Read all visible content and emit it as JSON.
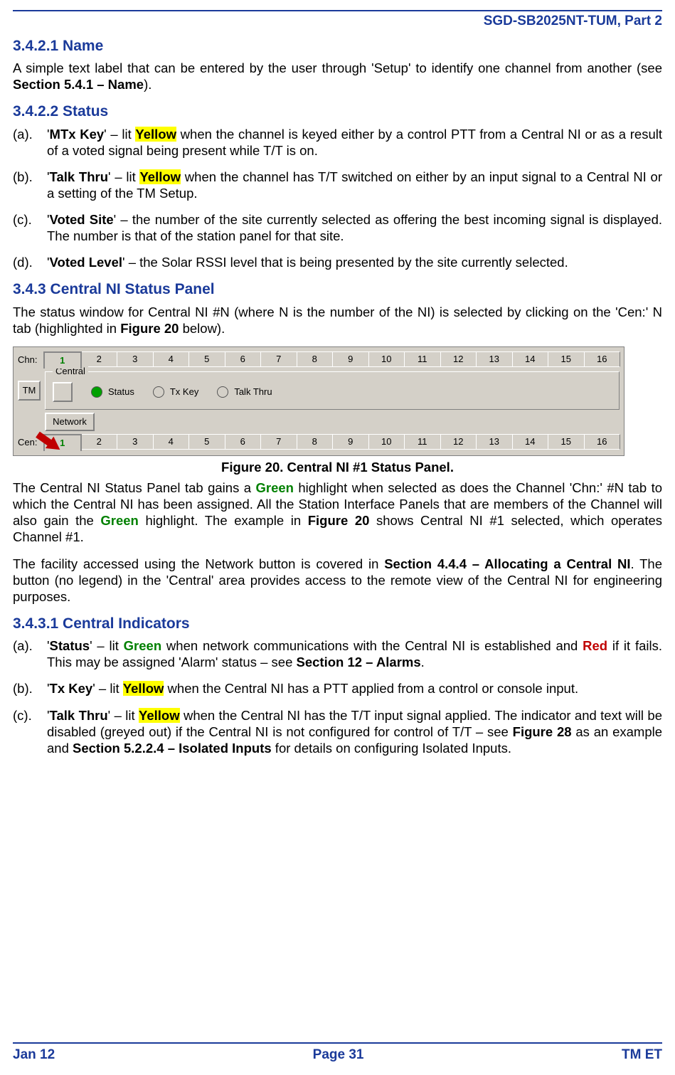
{
  "header": {
    "doc_id": "SGD-SB2025NT-TUM, Part 2"
  },
  "sections": {
    "s3421": {
      "num_title": "3.4.2.1    Name",
      "p1_a": "A simple text label that can be entered by the user through 'Setup' to identify one channel from another (see ",
      "p1_b": "Section 5.4.1 – Name",
      "p1_c": ")."
    },
    "s3422": {
      "num_title": "3.4.2.2    Status",
      "a_marker": "(a).",
      "a_lbl": "MTx Key",
      "a_mid": "' – lit ",
      "a_hl": "Yellow",
      "a_rest": " when the channel is keyed either by a control PTT from a Central NI or as a result of a voted signal being present while T/T is on.",
      "b_marker": "(b).",
      "b_lbl": "Talk Thru",
      "b_mid": "' – lit ",
      "b_hl": "Yellow",
      "b_rest": " when the channel has T/T switched on either by an input signal to a Central NI or a setting of the TM Setup.",
      "c_marker": "(c).",
      "c_lbl": "Voted Site",
      "c_rest": "' – the number of the site currently selected as offering the best incoming signal is displayed.  The number is that of the station panel for that site.",
      "d_marker": "(d).",
      "d_lbl": "Voted Level",
      "d_rest": "' – the Solar RSSI level that is being presented by the site currently selected."
    },
    "s343": {
      "num_title": "3.4.3    Central NI Status Panel",
      "p1_a": "The status window for Central NI #N (where N is the number of the NI) is selected by clicking on the 'Cen:' N tab (highlighted in ",
      "p1_b": "Figure 20",
      "p1_c": " below).",
      "caption": "Figure 20.  Central NI #1 Status Panel.",
      "p2_a": "The Central NI Status Panel tab gains a ",
      "p2_green1": "Green",
      "p2_b": " highlight when selected as does the Channel 'Chn:' #N tab to which the Central NI has been assigned.   All the Station Interface Panels that are members of the Channel will also gain the ",
      "p2_green2": "Green",
      "p2_c": " highlight.  The example in ",
      "p2_fig": "Figure 20",
      "p2_d": " shows Central NI #1 selected, which operates Channel #1.",
      "p3_a": "The facility accessed using the Network button is covered in ",
      "p3_b": "Section 4.4.4 – Allocating a Central NI",
      "p3_c": ".  The button (no legend) in the 'Central' area provides access to the remote view of the Central NI for engineering purposes."
    },
    "s3431": {
      "num_title": "3.4.3.1    Central Indicators",
      "a_marker": "(a).",
      "a_lbl": "Status",
      "a_mid": "' – lit ",
      "a_green": "Green",
      "a_mid2": " when network communications with the Central NI is established and ",
      "a_red": "Red",
      "a_rest": " if it fails.  This may be assigned 'Alarm' status – see ",
      "a_sec": "Section 12 – Alarms",
      "a_end": ".",
      "b_marker": "(b).",
      "b_lbl": "Tx Key",
      "b_mid": "' – lit ",
      "b_hl": "Yellow",
      "b_rest": " when the Central NI has a PTT applied from a control or console input.",
      "c_marker": "(c).",
      "c_lbl": "Talk Thru",
      "c_mid": "' – lit ",
      "c_hl": "Yellow",
      "c_rest1": " when the Central NI has the T/T input signal applied.  The indicator and text will be disabled (greyed out) if the Central NI is not configured for control of T/T – see ",
      "c_fig": "Figure 28",
      "c_rest2": " as an example and ",
      "c_sec": "Section 5.2.2.4 – Isolated Inputs",
      "c_rest3": " for details on configuring Isolated Inputs."
    }
  },
  "figure": {
    "chn_label": "Chn:",
    "chn_tabs": [
      "1",
      "2",
      "3",
      "4",
      "5",
      "6",
      "7",
      "8",
      "9",
      "10",
      "11",
      "12",
      "13",
      "14",
      "15",
      "16"
    ],
    "chn_selected_index": 0,
    "tm_label": "TM",
    "group_title": "Central",
    "status_label": "Status",
    "txkey_label": "Tx Key",
    "talkthru_label": "Talk Thru",
    "network_btn": "Network",
    "cen_label": "Cen:",
    "cen_tabs": [
      "1",
      "2",
      "3",
      "4",
      "5",
      "6",
      "7",
      "8",
      "9",
      "10",
      "11",
      "12",
      "13",
      "14",
      "15",
      "16"
    ],
    "cen_selected_index": 0
  },
  "footer": {
    "left": "Jan 12",
    "center": "Page 31",
    "right": "TM ET"
  }
}
